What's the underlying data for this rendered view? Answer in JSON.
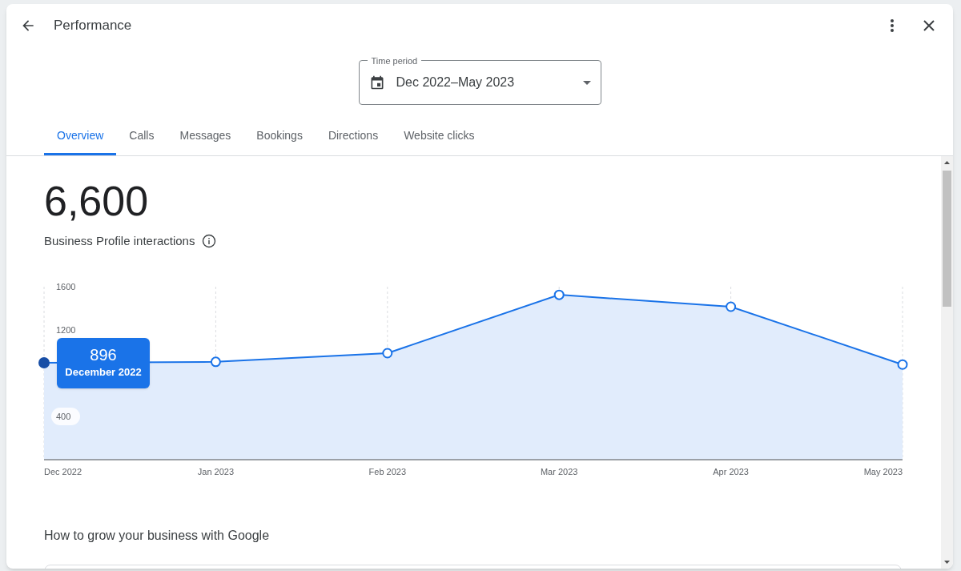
{
  "header": {
    "title": "Performance"
  },
  "time_period": {
    "label": "Time period",
    "value": "Dec 2022–May 2023"
  },
  "tabs": [
    {
      "label": "Overview",
      "selected": true
    },
    {
      "label": "Calls",
      "selected": false
    },
    {
      "label": "Messages",
      "selected": false
    },
    {
      "label": "Bookings",
      "selected": false
    },
    {
      "label": "Directions",
      "selected": false
    },
    {
      "label": "Website clicks",
      "selected": false
    }
  ],
  "summary": {
    "total": "6,600",
    "label": "Business Profile interactions"
  },
  "chart": {
    "tooltip": {
      "value": "896",
      "label": "December 2022"
    },
    "chart_data": {
      "type": "area",
      "categories": [
        "Dec 2022",
        "Jan 2023",
        "Feb 2023",
        "Mar 2023",
        "Apr 2023",
        "May 2023"
      ],
      "series": [
        {
          "color": "#1a73e8",
          "values": [
            896,
            905,
            985,
            1525,
            1415,
            880
          ]
        }
      ],
      "ylim": [
        0,
        1600
      ],
      "yticks": [
        400,
        1200,
        1600
      ],
      "grid": true
    }
  },
  "section": {
    "title": "How to grow your business with Google"
  }
}
